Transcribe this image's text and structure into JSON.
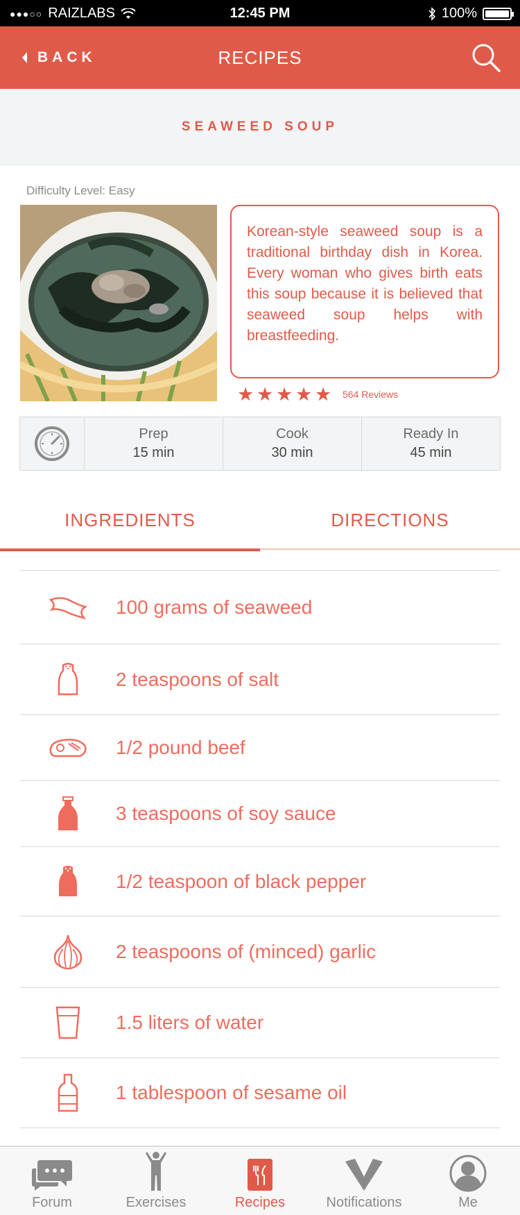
{
  "status_bar": {
    "carrier": "RAIZLABS",
    "time": "12:45 PM",
    "battery": "100%"
  },
  "nav": {
    "back_label": "BACK",
    "title": "RECIPES"
  },
  "recipe": {
    "title": "SEAWEED SOUP",
    "difficulty": "Difficulty Level: Easy",
    "description": "Korean-style seaweed soup is a traditional birthday dish in Korea. Every woman who gives birth eats this soup because it is believed that seaweed soup helps with breastfeeding.",
    "rating_stars": 5,
    "reviews": "564 Reviews"
  },
  "times": [
    {
      "label": "Prep",
      "value": "15 min"
    },
    {
      "label": "Cook",
      "value": "30 min"
    },
    {
      "label": "Ready In",
      "value": "45 min"
    }
  ],
  "tabs": {
    "ingredients": "INGREDIENTS",
    "directions": "DIRECTIONS",
    "active": "ingredients"
  },
  "ingredients": [
    {
      "text": "100 grams of seaweed",
      "icon": "seaweed-icon"
    },
    {
      "text": "2 teaspoons of salt",
      "icon": "salt-shaker-icon"
    },
    {
      "text": "1/2 pound beef",
      "icon": "steak-icon"
    },
    {
      "text": "3 teaspoons of soy sauce",
      "icon": "soy-sauce-bottle-icon"
    },
    {
      "text": "1/2 teaspoon of black pepper",
      "icon": "pepper-shaker-icon"
    },
    {
      "text": "2 teaspoons of (minced) garlic",
      "icon": "garlic-icon"
    },
    {
      "text": "1.5 liters of water",
      "icon": "water-glass-icon"
    },
    {
      "text": "1 tablespoon of sesame oil",
      "icon": "oil-bottle-icon"
    }
  ],
  "tabbar": {
    "forum": "Forum",
    "exercises": "Exercises",
    "recipes": "Recipes",
    "notifications": "Notifications",
    "me": "Me"
  },
  "colors": {
    "accent": "#e05a4a",
    "ingredient_text": "#ee6c5e"
  }
}
